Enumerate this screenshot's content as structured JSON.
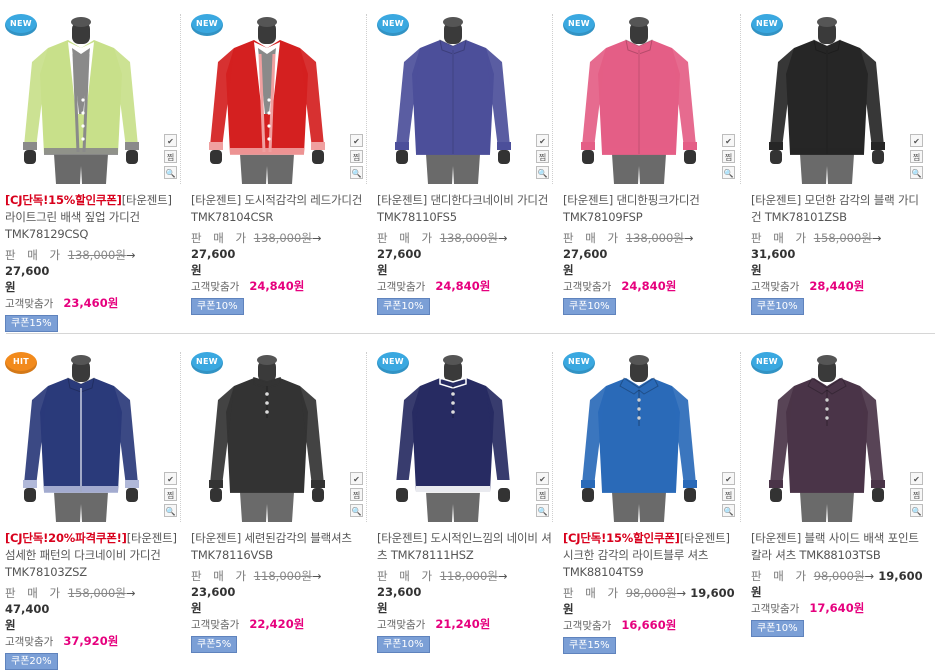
{
  "labels": {
    "price_label": "판 매 가",
    "customer_label": "고객맞춤가",
    "currency": "원",
    "arrow": "→"
  },
  "tools": {
    "check": "✔",
    "zzim": "찜",
    "zoom": "🔍"
  },
  "row1": [
    {
      "badge": "NEW",
      "badge_type": "new",
      "promo": "[CJ단독!15%할인쿠폰]",
      "name": "[타운젠트] 라이트그린 배색 짚업 가디건 TMK78129CSQ",
      "old_price": "138,000원",
      "new_price": "27,600",
      "cust_price": "23,460원",
      "coupon": "쿠폰15%",
      "garment": "#c8e08a",
      "trim": "#8a8a8a",
      "style": "cardigan"
    },
    {
      "badge": "NEW",
      "badge_type": "new",
      "promo": "",
      "name": "[타운젠트] 도시적감각의 레드가디건 TMK78104CSR",
      "old_price": "138,000원",
      "new_price": "27,600",
      "cust_price": "24,840원",
      "coupon": "쿠폰10%",
      "garment": "#d42020",
      "trim": "#f0a0a0",
      "style": "cardigan"
    },
    {
      "badge": "NEW",
      "badge_type": "new",
      "promo": "",
      "name": "[타운젠트] 댄디한다크네이비 가디건 TMK78110FS5",
      "old_price": "138,000원",
      "new_price": "27,600",
      "cust_price": "24,840원",
      "coupon": "쿠폰10%",
      "garment": "#4c4f9a",
      "trim": "#4c4f9a",
      "style": "zip"
    },
    {
      "badge": "NEW",
      "badge_type": "new",
      "promo": "",
      "name": "[타운젠트] 댄디한핑크가디건 TMK78109FSP",
      "old_price": "138,000원",
      "new_price": "27,600",
      "cust_price": "24,840원",
      "coupon": "쿠폰10%",
      "garment": "#e45e86",
      "trim": "#e45e86",
      "style": "zip"
    },
    {
      "badge": "NEW",
      "badge_type": "new",
      "promo": "",
      "name": "[타운젠트] 모던한 감각의 블랙 가디건 TMK78101ZSB",
      "old_price": "158,000원",
      "new_price": "31,600",
      "cust_price": "28,440원",
      "coupon": "쿠폰10%",
      "garment": "#262626",
      "trim": "#262626",
      "style": "zip"
    }
  ],
  "row2": [
    {
      "badge": "HIT",
      "badge_type": "hit",
      "promo": "[CJ단독!20%파격쿠폰!]",
      "name": "[타운젠트] 섬세한 패턴의 다크네이비 가디건 TMK78103ZSZ",
      "old_price": "158,000원",
      "new_price": "47,400",
      "cust_price": "37,920원",
      "coupon": "쿠폰20%",
      "garment": "#2a3a7a",
      "trim": "#b0b8d8",
      "style": "zip"
    },
    {
      "badge": "NEW",
      "badge_type": "new",
      "promo": "",
      "name": "[타운젠트] 세련된감각의 블랙셔츠 TMK78116VSB",
      "old_price": "118,000원",
      "new_price": "23,600",
      "cust_price": "22,420원",
      "coupon": "쿠폰5%",
      "garment": "#333333",
      "trim": "#333333",
      "style": "henley"
    },
    {
      "badge": "NEW",
      "badge_type": "new",
      "promo": "",
      "name": "[타운젠트] 도시적인느낌의 네이비 셔츠 TMK78111HSZ",
      "old_price": "118,000원",
      "new_price": "23,600",
      "cust_price": "21,240원",
      "coupon": "쿠폰10%",
      "garment": "#272b62",
      "trim": "#ffffff",
      "style": "henley"
    },
    {
      "badge": "NEW",
      "badge_type": "new",
      "promo": "[CJ단독!15%할인쿠폰]",
      "name": "[타운젠트] 시크한 감각의 라이트블루 셔츠 TMK88104TS9",
      "old_price": "98,000원",
      "new_price": "19,600",
      "cust_price": "16,660원",
      "coupon": "쿠폰15%",
      "garment": "#2a6ab8",
      "trim": "#2a6ab8",
      "style": "polo"
    },
    {
      "badge": "NEW",
      "badge_type": "new",
      "promo": "",
      "name": "[타운젠트] 블랙 사이드 배색 포인트 칼라 셔츠 TMK88103TSB",
      "old_price": "98,000원",
      "new_price": "19,600",
      "cust_price": "17,640원",
      "coupon": "쿠폰10%",
      "garment": "#4a3448",
      "trim": "#4a3448",
      "style": "polo"
    }
  ]
}
